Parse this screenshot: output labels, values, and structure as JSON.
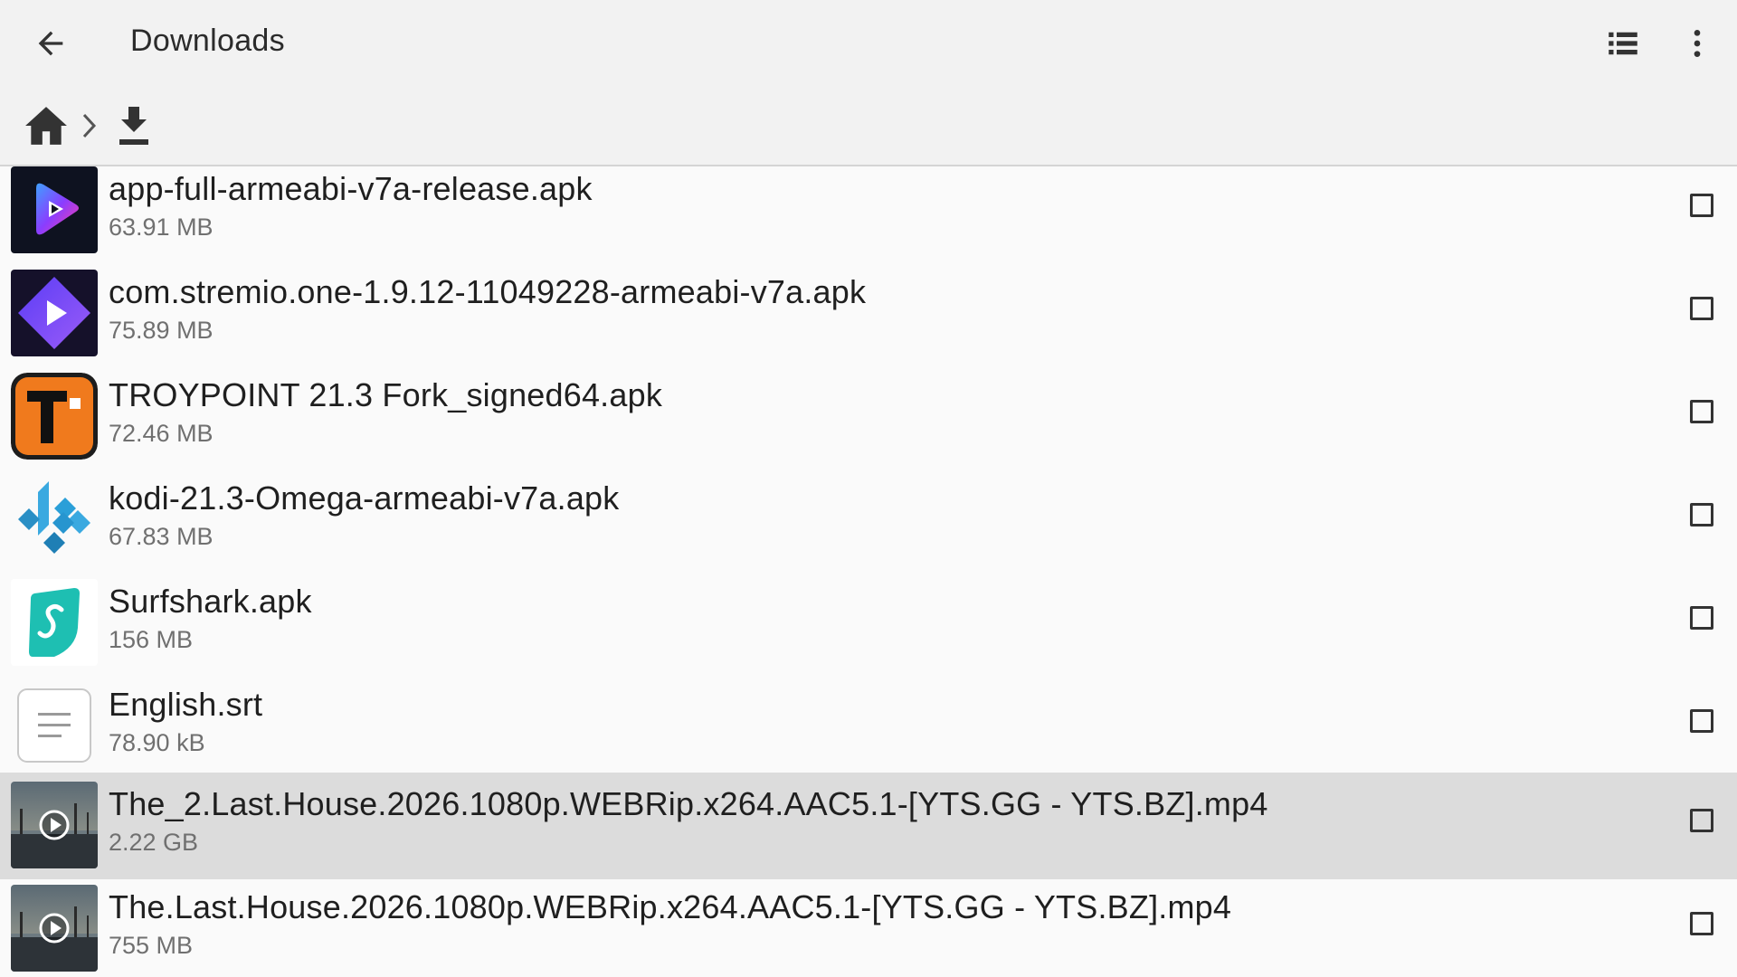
{
  "appbar": {
    "back_icon": "arrow-left-icon",
    "title": "Downloads",
    "list_view_icon": "list-view-icon",
    "more_icon": "more-vert-icon"
  },
  "breadcrumb": {
    "home_icon": "home-icon",
    "separator_icon": "chevron-right-icon",
    "current_icon": "download-icon"
  },
  "files": [
    {
      "name": "app-full-armeabi-v7a-release.apk",
      "size": "63.91 MB",
      "icon": "purple-play-app-icon",
      "selected": false
    },
    {
      "name": "com.stremio.one-1.9.12-11049228-armeabi-v7a.apk",
      "size": "75.89 MB",
      "icon": "stremio-app-icon",
      "selected": false
    },
    {
      "name": "TROYPOINT 21.3 Fork_signed64.apk",
      "size": "72.46 MB",
      "icon": "troypoint-app-icon",
      "selected": false
    },
    {
      "name": "kodi-21.3-Omega-armeabi-v7a.apk",
      "size": "67.83 MB",
      "icon": "kodi-app-icon",
      "selected": false
    },
    {
      "name": "Surfshark.apk",
      "size": "156 MB",
      "icon": "surfshark-app-icon",
      "selected": false
    },
    {
      "name": "English.srt",
      "size": "78.90 kB",
      "icon": "text-file-icon",
      "selected": false
    },
    {
      "name": "The_2.Last.House.2026.1080p.WEBRip.x264.AAC5.1-[YTS.GG - YTS.BZ].mp4",
      "size": "2.22 GB",
      "icon": "video-thumbnail-play-icon",
      "selected": true
    },
    {
      "name": "The.Last.House.2026.1080p.WEBRip.x264.AAC5.1-[YTS.GG - YTS.BZ].mp4",
      "size": "755 MB",
      "icon": "video-thumbnail-play-icon",
      "selected": false
    }
  ],
  "colors": {
    "appbar_bg": "#f2f2f2",
    "list_bg": "#fafafa",
    "selected_row_bg": "#dcdcdc",
    "troypoint_orange": "#f07a1d",
    "stremio_purple": "#7b4cf0",
    "kodi_blue": "#2a9fd8",
    "surfshark_teal": "#1ebfb2"
  }
}
